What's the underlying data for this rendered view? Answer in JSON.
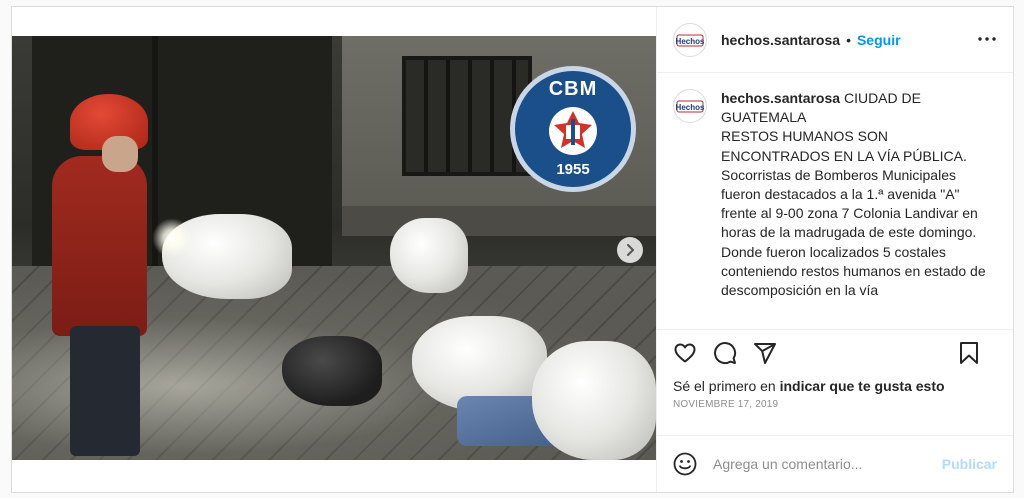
{
  "post": {
    "username": "hechos.santarosa",
    "separator": "•",
    "follow_label": "Seguir",
    "avatar_text": "Hechos",
    "logo": {
      "top_text": "CBM",
      "year": "1955"
    },
    "caption": {
      "username": "hechos.santarosa",
      "text": " CIUDAD DE GUATEMALA\nRESTOS HUMANOS SON ENCONTRADOS EN LA VÍA PÚBLICA.\nSocorristas de Bomberos Municipales fueron destacados a la 1.ª avenida \"A\" frente al 9-00 zona 7 Colonia Landivar en horas de la madrugada de este domingo.\nDonde fueron localizados 5 costales conteniendo restos humanos en estado de descomposición en la vía"
    },
    "likes": {
      "prefix": "Sé el primero en ",
      "action": "indicar que te gusta esto"
    },
    "date": "NOVIEMBRE 17, 2019",
    "comment": {
      "placeholder": "Agrega un comentario...",
      "publish_label": "Publicar"
    }
  },
  "icons": {
    "like": "heart-icon",
    "comment": "comment-icon",
    "share": "share-icon",
    "save": "bookmark-icon",
    "emoji": "emoji-icon",
    "more": "more-options-icon",
    "next": "chevron-right-icon"
  },
  "colors": {
    "follow": "#0095f6",
    "publish_disabled": "#b3dbff",
    "muted_text": "#8e8e8e",
    "border": "#dbdbdb"
  }
}
